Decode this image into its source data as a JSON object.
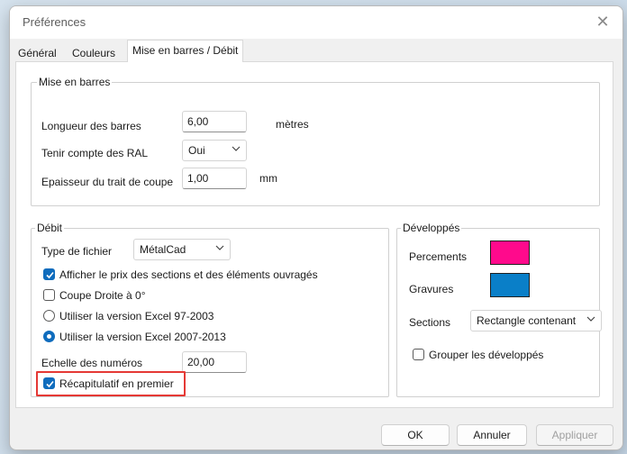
{
  "window": {
    "title": "Préférences"
  },
  "tabs": [
    {
      "label": "Général"
    },
    {
      "label": "Couleurs"
    },
    {
      "label": "Mise en barres / Débit"
    }
  ],
  "mise_en_barres": {
    "legend": "Mise en barres",
    "longueur_label": "Longueur des barres",
    "longueur_value": "6,00",
    "longueur_unit": "mètres",
    "ral_label": "Tenir compte des RAL",
    "ral_value": "Oui",
    "epaisseur_label": "Epaisseur du trait de coupe",
    "epaisseur_value": "1,00",
    "epaisseur_unit": "mm"
  },
  "debit": {
    "legend": "Débit",
    "type_fichier_label": "Type de fichier",
    "type_fichier_value": "MétalCad",
    "options": [
      {
        "label": "Afficher le prix des sections et des éléments ouvragés",
        "checked": true
      },
      {
        "label": "Coupe Droite à 0°",
        "checked": false
      }
    ],
    "radios": [
      {
        "label": "Utiliser la version Excel 97-2003",
        "selected": false
      },
      {
        "label": "Utiliser la version Excel 2007-2013",
        "selected": true
      }
    ],
    "echelle_label": "Echelle des numéros",
    "echelle_value": "20,00",
    "recap_label": "Récapitulatif en premier",
    "recap_checked": true
  },
  "developpes": {
    "legend": "Développés",
    "percements_label": "Percements",
    "percements_color": "#ff0a8c",
    "gravures_label": "Gravures",
    "gravures_color": "#0a7fc8",
    "sections_label": "Sections",
    "sections_value": "Rectangle contenant",
    "grouper_label": "Grouper les développés",
    "grouper_checked": false
  },
  "buttons": {
    "ok": "OK",
    "annuler": "Annuler",
    "appliquer": "Appliquer"
  },
  "colors": {
    "accent": "#0f6cbd",
    "highlight": "#e53935"
  }
}
